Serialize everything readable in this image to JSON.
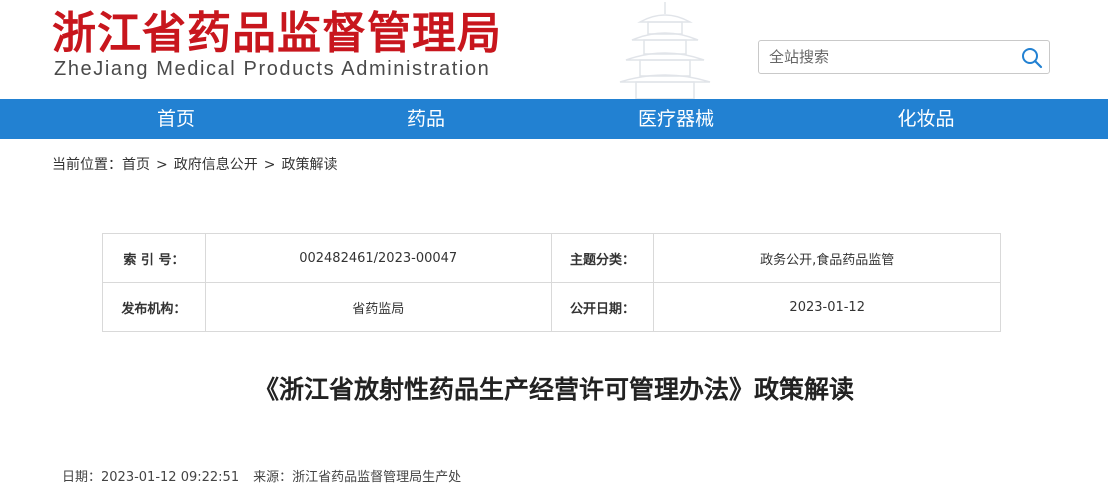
{
  "header": {
    "title_cn": "浙江省药品监督管理局",
    "title_en": "ZheJiang Medical Products Administration"
  },
  "search": {
    "placeholder": "全站搜索"
  },
  "nav": {
    "items": [
      {
        "label": "首页"
      },
      {
        "label": "药品"
      },
      {
        "label": "医疗器械"
      },
      {
        "label": "化妆品"
      }
    ]
  },
  "breadcrumb": {
    "prefix": "当前位置：",
    "items": [
      "首页",
      "政府信息公开",
      "政策解读"
    ],
    "separator": ">"
  },
  "info": {
    "index_label": "索 引 号：",
    "index_value": "002482461/2023-00047",
    "topic_label": "主题分类：",
    "topic_value": "政务公开,食品药品监管",
    "publisher_label": "发布机构：",
    "publisher_value": "省药监局",
    "date_label": "公开日期：",
    "date_value": "2023-01-12"
  },
  "article": {
    "title": "《浙江省放射性药品生产经营许可管理办法》政策解读",
    "date_label": "日期：",
    "date_value": "2023-01-12 09:22:51",
    "source_label": "来源：",
    "source_value": "浙江省药品监督管理局生产处"
  },
  "colors": {
    "brand_red": "#c8161d",
    "nav_blue": "#2281d2"
  }
}
